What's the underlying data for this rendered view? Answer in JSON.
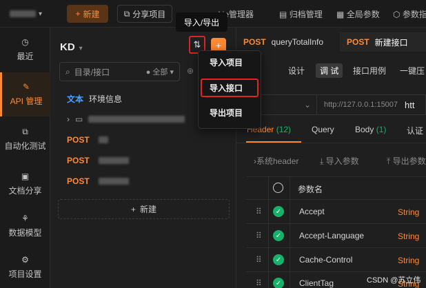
{
  "topbar": {
    "team_label": "",
    "new_label": "新建",
    "share_label": "分享项目",
    "cookie_label": "okie管理器",
    "archive_label": "归档管理",
    "global_label": "全局参数",
    "params_label": "参数指"
  },
  "tooltip": "导入/导出",
  "nav": [
    {
      "label": "最近"
    },
    {
      "label": "API 管理"
    },
    {
      "label": "自动化测试"
    },
    {
      "label": "文档分享"
    },
    {
      "label": "数据模型"
    },
    {
      "label": "项目设置"
    }
  ],
  "tree": {
    "project": "KD",
    "search_placeholder": "目录/接口",
    "filter": "全部",
    "doc_tag": "文本",
    "doc_name": "环境信息",
    "post_tag": "POST",
    "add_label": "新建"
  },
  "dropdown": {
    "items": [
      "导入项目",
      "导入接口",
      "导出项目"
    ],
    "highlighted": "导入接口"
  },
  "tabs": [
    {
      "method": "POST",
      "name": "queryTotalInfo"
    },
    {
      "method": "POST",
      "name": "新建接口"
    }
  ],
  "subtabs": [
    "设计",
    "调 试",
    "接口用例",
    "一键压"
  ],
  "url": {
    "base": "http://127.0.0.1:15007",
    "suffix": "htt"
  },
  "param_tabs": {
    "header": "Header",
    "header_count": "(12)",
    "query": "Query",
    "body": "Body",
    "body_count": "(1)",
    "auth": "认证"
  },
  "tools": {
    "system_header": "系统header",
    "import_params": "导入参数",
    "export_params": "导出参数"
  },
  "table": {
    "col_name": "参数名",
    "rows": [
      {
        "name": "Accept",
        "type": "String"
      },
      {
        "name": "Accept-Language",
        "type": "String"
      },
      {
        "name": "Cache-Control",
        "type": "String"
      },
      {
        "name": "ClientTag",
        "type": "String"
      }
    ]
  },
  "watermark": "CSDN @苏立伟",
  "colors": {
    "accent": "#ff8a33",
    "highlight": "#e02424",
    "success": "#17b26a",
    "doc": "#4fa3ff"
  }
}
